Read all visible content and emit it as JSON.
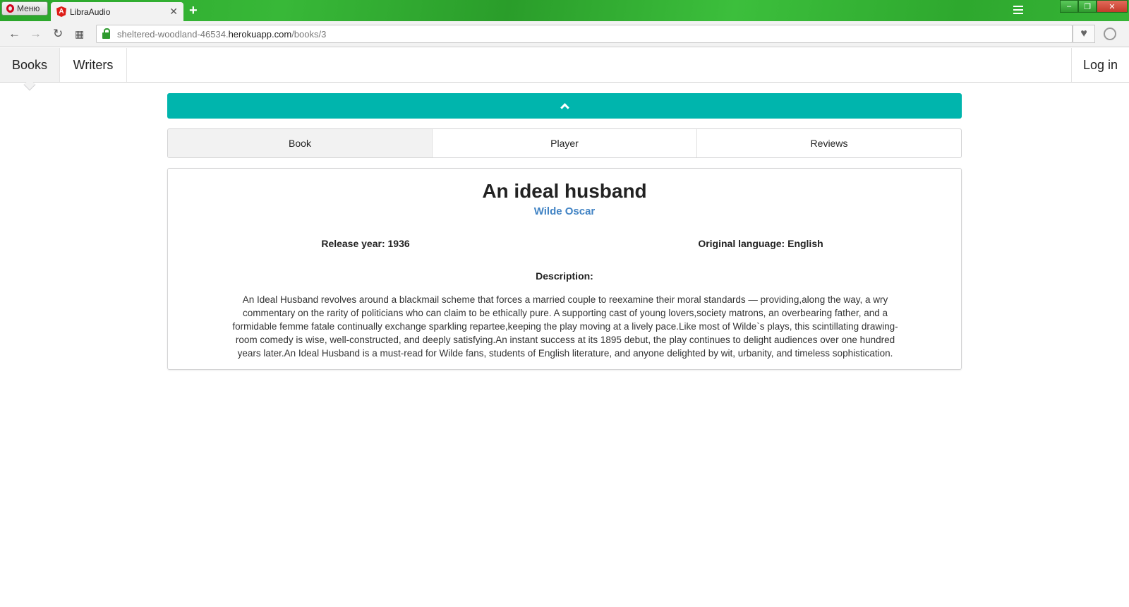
{
  "browser": {
    "menu_label": "Меню",
    "tab_title": "LibraAudio",
    "url_prefix": "sheltered-woodland-46534.",
    "url_host": "herokuapp.com",
    "url_path": "/books/3"
  },
  "navbar": {
    "books": "Books",
    "writers": "Writers",
    "login": "Log in"
  },
  "tabs": [
    "Book",
    "Player",
    "Reviews"
  ],
  "book": {
    "title": "An ideal husband",
    "author": "Wilde Oscar",
    "release_year": "Release year: 1936",
    "original_language": "Original language: English",
    "description_label": "Description:",
    "description": "An Ideal Husband revolves around a blackmail scheme that forces a married couple to reexamine their moral standards — providing,along the way, a wry commentary on the rarity of politicians who can claim to be ethically pure. A supporting cast of young lovers,society matrons, an overbearing father, and a formidable femme fatale continually exchange sparkling repartee,keeping the play moving at a lively pace.Like most of Wilde`s plays, this scintillating drawing-room comedy is wise, well-constructed, and deeply satisfying.An instant success at its 1895 debut, the play continues to delight audiences over one hundred years later.An Ideal Husband is a must-read for Wilde fans, students of English literature, and anyone delighted by wit, urbanity, and timeless sophistication."
  },
  "colors": {
    "accent": "#00b5ad",
    "link": "#4183c4"
  }
}
